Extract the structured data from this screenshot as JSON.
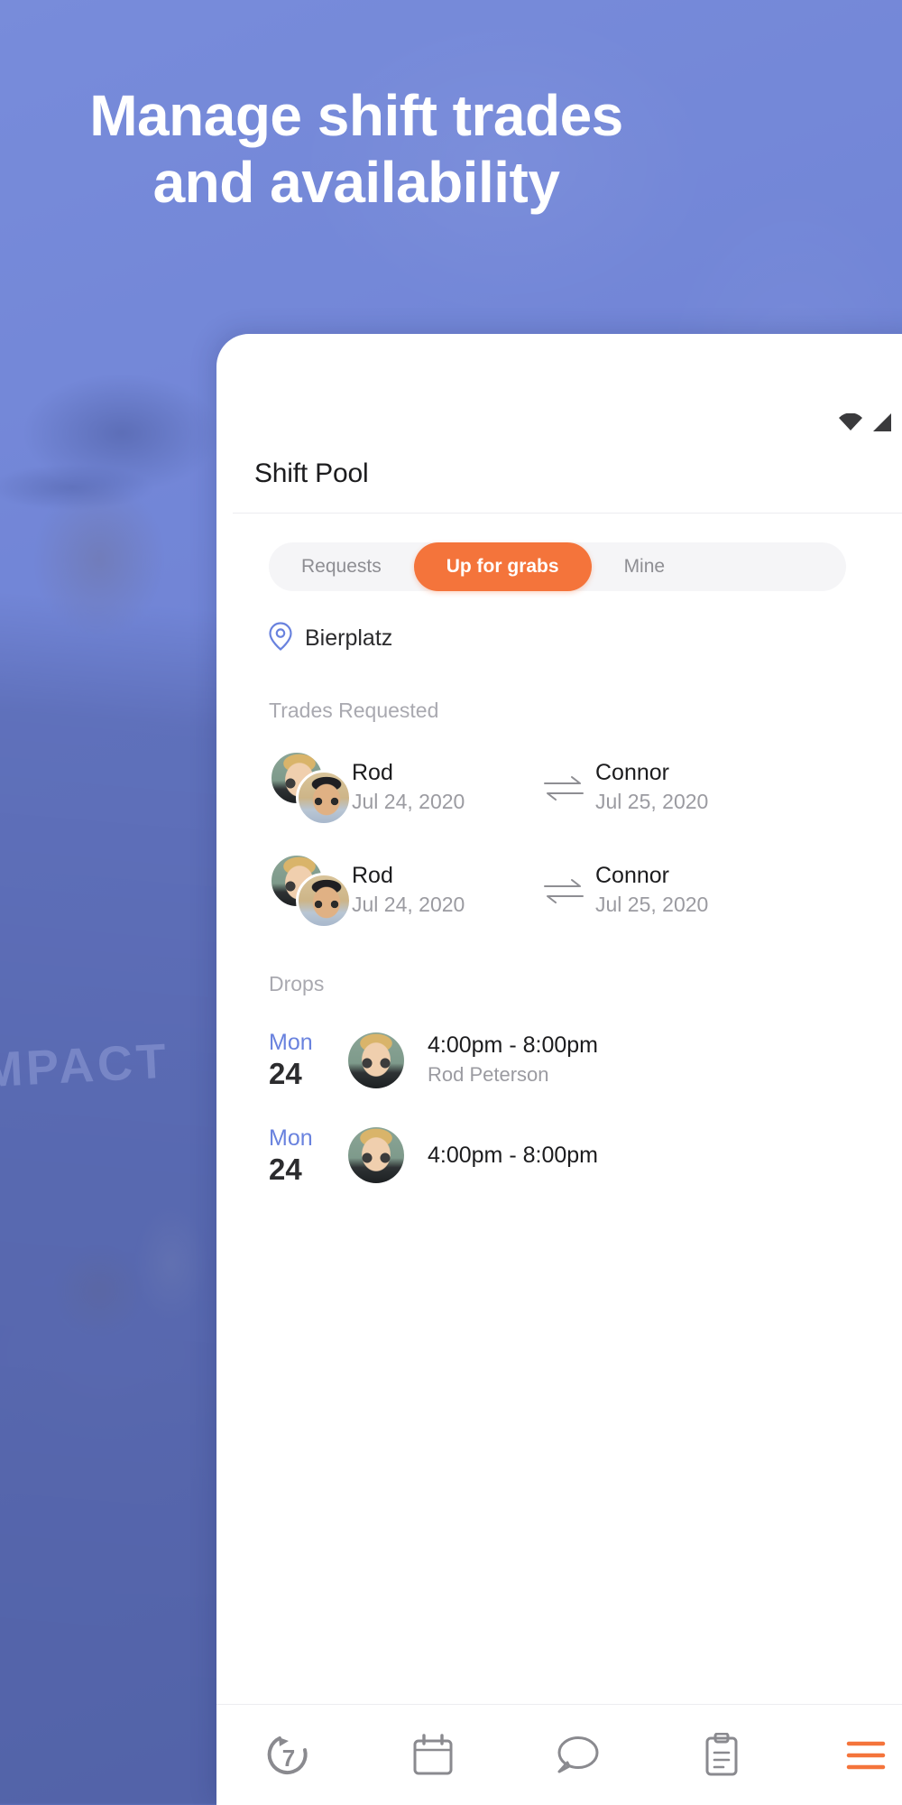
{
  "background": {
    "headline_line1": "Manage shift trades",
    "headline_line2": "and availability",
    "shirt_text": "MPACT",
    "accent_orange": "#f4743b",
    "brand_blue": "#6982de",
    "backdrop_blue": "#7284d6"
  },
  "phone": {
    "statusbar": {
      "wifi_icon": "wifi-icon",
      "signal_icon": "cellular-signal-icon",
      "battery_icon": "battery-icon"
    },
    "screen_title": "Shift Pool",
    "tabs": [
      {
        "label": "Requests",
        "active": false
      },
      {
        "label": "Up for grabs",
        "active": true
      },
      {
        "label": "Mine",
        "active": false
      }
    ],
    "location": {
      "icon": "location-pin-icon",
      "name": "Bierplatz"
    },
    "sections": [
      {
        "heading": "Trades Requested",
        "rows": [
          {
            "from_name": "Rod",
            "from_date": "Jul 24, 2020",
            "swap_icon": "swap-arrows-icon",
            "to_name": "Connor",
            "to_date": "Jul 25, 2020"
          },
          {
            "from_name": "Rod",
            "from_date": "Jul 24, 2020",
            "swap_icon": "swap-arrows-icon",
            "to_name": "Connor",
            "to_date": "Jul 25, 2020"
          }
        ]
      },
      {
        "heading": "Drops",
        "rows": [
          {
            "day_of_week": "Mon",
            "day_number": "24",
            "time_range": "4:00pm - 8:00pm",
            "person": "Rod Peterson"
          },
          {
            "day_of_week": "Mon",
            "day_number": "24",
            "time_range": "4:00pm - 8:00pm",
            "person": ""
          }
        ]
      }
    ],
    "bottom_nav": [
      {
        "icon": "seven-shifts-logo-icon",
        "active": false
      },
      {
        "icon": "calendar-icon",
        "active": false
      },
      {
        "icon": "chat-bubble-icon",
        "active": false
      },
      {
        "icon": "clipboard-icon",
        "active": false
      },
      {
        "icon": "menu-hamburger-icon",
        "active": true
      }
    ]
  }
}
